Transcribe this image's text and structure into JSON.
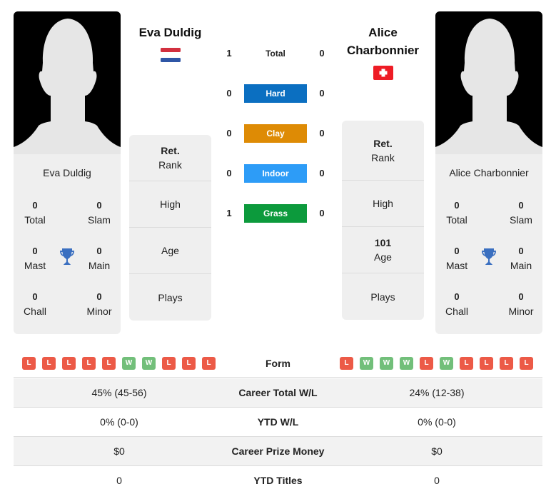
{
  "player1": {
    "name": "Eva Duldig",
    "card_name": "Eva Duldig",
    "flag": "netherlands-flag",
    "titles": {
      "total": {
        "value": "0",
        "label": "Total"
      },
      "slam": {
        "value": "0",
        "label": "Slam"
      },
      "mast": {
        "value": "0",
        "label": "Mast"
      },
      "main": {
        "value": "0",
        "label": "Main"
      },
      "chall": {
        "value": "0",
        "label": "Chall"
      },
      "minor": {
        "value": "0",
        "label": "Minor"
      }
    },
    "info": {
      "rank_value": "Ret.",
      "rank_label": "Rank",
      "high_value": "",
      "high_label": "High",
      "age_value": "",
      "age_label": "Age",
      "plays_value": "",
      "plays_label": "Plays"
    },
    "form": [
      "L",
      "L",
      "L",
      "L",
      "L",
      "W",
      "W",
      "L",
      "L",
      "L"
    ]
  },
  "player2": {
    "name_line1": "Alice",
    "name_line2": "Charbonnier",
    "card_name": "Alice Charbonnier",
    "flag": "switzerland-flag",
    "titles": {
      "total": {
        "value": "0",
        "label": "Total"
      },
      "slam": {
        "value": "0",
        "label": "Slam"
      },
      "mast": {
        "value": "0",
        "label": "Mast"
      },
      "main": {
        "value": "0",
        "label": "Main"
      },
      "chall": {
        "value": "0",
        "label": "Chall"
      },
      "minor": {
        "value": "0",
        "label": "Minor"
      }
    },
    "info": {
      "rank_value": "Ret.",
      "rank_label": "Rank",
      "high_value": "",
      "high_label": "High",
      "age_value": "101",
      "age_label": "Age",
      "plays_value": "",
      "plays_label": "Plays"
    },
    "form": [
      "L",
      "W",
      "W",
      "W",
      "L",
      "W",
      "L",
      "L",
      "L",
      "L"
    ]
  },
  "h2h": [
    {
      "label": "Total",
      "p1": "1",
      "p2": "0",
      "color": ""
    },
    {
      "label": "Hard",
      "p1": "0",
      "p2": "0",
      "color": "#0b6fc1"
    },
    {
      "label": "Clay",
      "p1": "0",
      "p2": "0",
      "color": "#de8b05"
    },
    {
      "label": "Indoor",
      "p1": "0",
      "p2": "0",
      "color": "#2d9cf7"
    },
    {
      "label": "Grass",
      "p1": "1",
      "p2": "0",
      "color": "#0c9a3c"
    }
  ],
  "form_label": "Form",
  "stats": [
    {
      "label": "Career Total W/L",
      "p1": "45% (45-56)",
      "p2": "24% (12-38)"
    },
    {
      "label": "YTD W/L",
      "p1": "0% (0-0)",
      "p2": "0% (0-0)"
    },
    {
      "label": "Career Prize Money",
      "p1": "$0",
      "p2": "$0"
    },
    {
      "label": "YTD Titles",
      "p1": "0",
      "p2": "0"
    }
  ]
}
